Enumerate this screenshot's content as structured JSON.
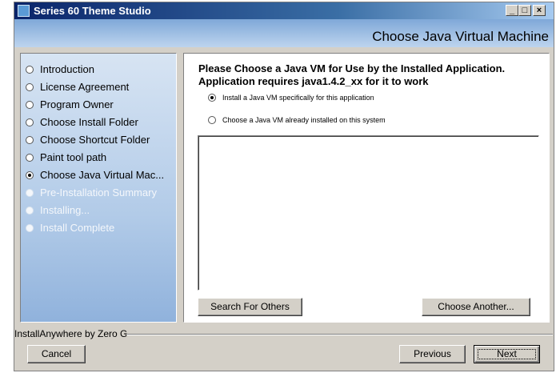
{
  "window": {
    "title": "Series 60 Theme Studio",
    "minimize": "_",
    "maximize": "□",
    "close": "×"
  },
  "header": {
    "page_title": "Choose Java Virtual Machine"
  },
  "steps": [
    {
      "label": "Introduction",
      "state": "done"
    },
    {
      "label": "License Agreement",
      "state": "done"
    },
    {
      "label": "Program Owner",
      "state": "done"
    },
    {
      "label": "Choose Install Folder",
      "state": "done"
    },
    {
      "label": "Choose Shortcut Folder",
      "state": "done"
    },
    {
      "label": "Paint tool path",
      "state": "done"
    },
    {
      "label": "Choose Java Virtual Mac...",
      "state": "current"
    },
    {
      "label": "Pre-Installation Summary",
      "state": "future"
    },
    {
      "label": "Installing...",
      "state": "future"
    },
    {
      "label": "Install Complete",
      "state": "future"
    }
  ],
  "content": {
    "heading_line1": "Please Choose a Java VM for Use by the Installed Application.",
    "heading_line2": "Application requires java1.4.2_xx for it to work",
    "option_install": "Install a Java VM specifically for this application",
    "option_existing": "Choose a Java VM already installed on this system",
    "selected_option": "install",
    "search_button": "Search For Others",
    "choose_button": "Choose Another..."
  },
  "footer": {
    "vendor": "InstallAnywhere by Zero G",
    "cancel": "Cancel",
    "previous": "Previous",
    "next": "Next"
  },
  "colors": {
    "titlebar_start": "#0a246a",
    "header_band": "#9fbde2",
    "window_face": "#d4d0c8"
  }
}
